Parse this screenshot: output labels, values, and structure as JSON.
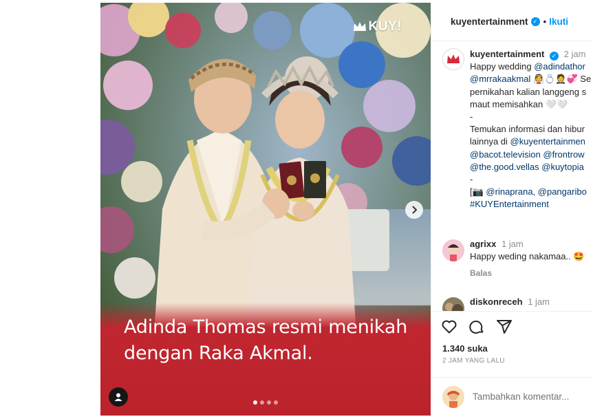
{
  "media": {
    "brand_label": "KUY!",
    "caption_line1": "Adinda Thomas resmi menikah",
    "caption_line2": "dengan Raka Akmal.",
    "carousel_count": 4,
    "carousel_active": 1,
    "next_icon": "chevron-right-icon",
    "user_tag_icon": "person-icon"
  },
  "header": {
    "username": "kuyentertainment",
    "separator": "•",
    "follow_label": "Ikuti"
  },
  "post": {
    "username": "kuyentertainment",
    "time": "2 jam",
    "lines": [
      {
        "pre": "Happy wedding ",
        "link": "@adindathor",
        "post": ""
      },
      {
        "pre": "",
        "link": "@mrrakaakmal",
        "post": " 👰💍🤵💞 Se"
      },
      {
        "pre": "pernikahan kalian langgeng s",
        "link": "",
        "post": ""
      },
      {
        "pre": "maut memisahkan 🤍🤍",
        "link": "",
        "post": ""
      },
      {
        "pre": "-",
        "link": "",
        "post": ""
      },
      {
        "pre": "Temukan informasi dan hibur",
        "link": "",
        "post": ""
      },
      {
        "pre": "lainnya di ",
        "link": "@kuyentertainmen",
        "post": ""
      },
      {
        "pre": "",
        "link": "@bacot.television @frontrow",
        "post": ""
      },
      {
        "pre": "",
        "link": "@the.good.vellas @kuytopia",
        "post": ""
      },
      {
        "pre": "-",
        "link": "",
        "post": ""
      },
      {
        "pre": "[📷 ",
        "link": "@rinaprana, @pangaribo",
        "post": ""
      },
      {
        "pre": "",
        "link": "#KUYEntertainment",
        "post": ""
      }
    ]
  },
  "comments": [
    {
      "username": "agrixx",
      "time": "1 jam",
      "text": "Happy weding nakamaa.. 🤩",
      "reply_label": "Balas"
    },
    {
      "username": "diskonreceh",
      "time": "1 jam",
      "text": "",
      "reply_label": ""
    }
  ],
  "actions": {
    "like_icon": "heart-icon",
    "comment_icon": "comment-icon",
    "share_icon": "share-icon",
    "likes": "1.340 suka",
    "time_ago": "2 JAM YANG LALU"
  },
  "add_comment": {
    "placeholder": "Tambahkan komentar..."
  },
  "colors": {
    "accent": "#0095f6",
    "caption_band": "#c0262f",
    "link": "#00376b"
  }
}
